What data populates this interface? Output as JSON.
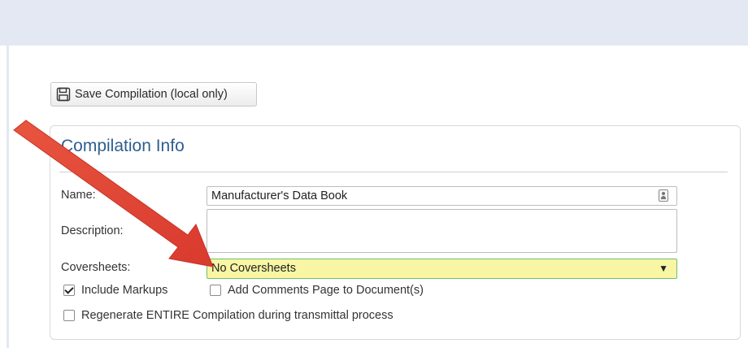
{
  "toolbar": {
    "save_label": "Save Compilation (local only)"
  },
  "panel": {
    "title": "Compilation Info",
    "name_label": "Name:",
    "name_value": "Manufacturer's Data Book",
    "description_label": "Description:",
    "description_value": "",
    "coversheets_label": "Coversheets:",
    "coversheets_selected": "No Coversheets",
    "include_markups_label": "Include Markups",
    "include_markups_checked": true,
    "add_comments_label": "Add Comments Page to Document(s)",
    "add_comments_checked": false,
    "regenerate_label": "Regenerate ENTIRE Compilation during transmittal process",
    "regenerate_checked": false
  },
  "annotation": {
    "arrow_color": "#e2463a"
  },
  "colors": {
    "highlight_select": "#f8f5a4",
    "title_blue": "#2f5f8f",
    "top_bar": "#e3e8f2"
  }
}
